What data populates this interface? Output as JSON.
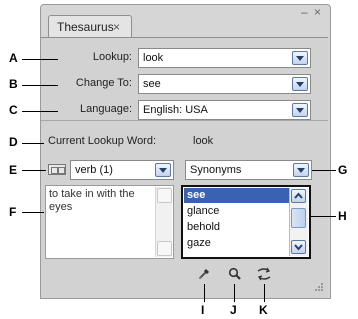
{
  "panel": {
    "tab_title": "Thesaurus",
    "tab_close": "×",
    "minimize": "–",
    "close": "×"
  },
  "fields": {
    "lookup_label": "Lookup:",
    "lookup_value": "look",
    "change_to_label": "Change To:",
    "change_to_value": "see",
    "language_label": "Language:",
    "language_value": "English: USA",
    "current_label": "Current Lookup Word:",
    "current_value": "look",
    "pos_value": "verb (1)",
    "relation_value": "Synonyms"
  },
  "definition": "to take in with the eyes",
  "synonyms": [
    "see",
    "glance",
    "behold",
    "gaze"
  ],
  "selected_synonym_index": 0,
  "callouts": [
    "A",
    "B",
    "C",
    "D",
    "E",
    "F",
    "G",
    "H",
    "I",
    "J",
    "K"
  ],
  "icons": [
    "dictionary-icon",
    "eyedropper-icon",
    "magnifier-icon",
    "replace-icon",
    "resize-grip-icon"
  ],
  "colors": {
    "selection": "#3a62b3",
    "panel": "#d2d2d2"
  }
}
